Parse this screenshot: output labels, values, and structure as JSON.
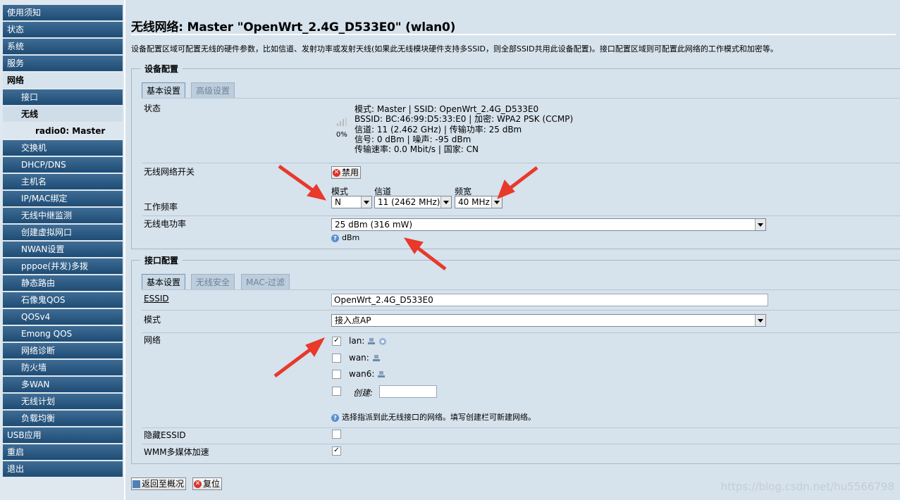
{
  "sidebar": {
    "items": [
      {
        "label": "使用须知"
      },
      {
        "label": "状态"
      },
      {
        "label": "系统"
      },
      {
        "label": "服务"
      },
      {
        "label": "网络"
      },
      {
        "label": "接口"
      },
      {
        "label": "无线"
      },
      {
        "label": "radio0: Master"
      },
      {
        "label": "交换机"
      },
      {
        "label": "DHCP/DNS"
      },
      {
        "label": "主机名"
      },
      {
        "label": "IP/MAC绑定"
      },
      {
        "label": "无线中继监测"
      },
      {
        "label": "创建虚拟网口"
      },
      {
        "label": "NWAN设置"
      },
      {
        "label": "pppoe(并发)多拨"
      },
      {
        "label": "静态路由"
      },
      {
        "label": "石像鬼QOS"
      },
      {
        "label": "QOSv4"
      },
      {
        "label": "Emong QOS"
      },
      {
        "label": "网络诊断"
      },
      {
        "label": "防火墙"
      },
      {
        "label": "多WAN"
      },
      {
        "label": "无线计划"
      },
      {
        "label": "负载均衡"
      },
      {
        "label": "USB应用"
      },
      {
        "label": "重启"
      },
      {
        "label": "退出"
      }
    ]
  },
  "page": {
    "title": "无线网络: Master \"OpenWrt_2.4G_D533E0\" (wlan0)",
    "description": "设备配置区域可配置无线的硬件参数，比如信道、发射功率或发射天线(如果此无线模块硬件支持多SSID，则全部SSID共用此设备配置)。接口配置区域则可配置此网络的工作模式和加密等。"
  },
  "device_config": {
    "legend": "设备配置",
    "tabs": [
      "基本设置",
      "高级设置"
    ],
    "status_label": "状态",
    "signal_percent": "0%",
    "status_lines": [
      "模式: Master | SSID: OpenWrt_2.4G_D533E0",
      "BSSID: BC:46:99:D5:33:E0 | 加密: WPA2 PSK (CCMP)",
      "信道: 11 (2.462 GHz) | 传输功率: 25 dBm",
      "信号: 0 dBm | 噪声: -95 dBm",
      "传输速率: 0.0 Mbit/s | 国家: CN"
    ],
    "switch_label": "无线网络开关",
    "disable_button": "禁用",
    "freq_label": "工作频率",
    "mode_caption": "模式",
    "mode_value": "N",
    "channel_caption": "信道",
    "channel_value": "11 (2462 MHz)",
    "width_caption": "频宽",
    "width_value": "40 MHz",
    "power_label": "无线电功率",
    "power_value": "25 dBm (316 mW)",
    "power_unit": "dBm"
  },
  "iface_config": {
    "legend": "接口配置",
    "tabs": [
      "基本设置",
      "无线安全",
      "MAC-过滤"
    ],
    "essid_label": "ESSID",
    "essid_value": "OpenWrt_2.4G_D533E0",
    "mode_label": "模式",
    "mode_value": "接入点AP",
    "network_label": "网络",
    "networks": [
      {
        "name": "lan:",
        "checked": true
      },
      {
        "name": "wan:",
        "checked": false
      },
      {
        "name": "wan6:",
        "checked": false
      }
    ],
    "create_label": "创建:",
    "network_help": "选择指派到此无线接口的网络。填写创建栏可新建网络。",
    "hidden_essid_label": "隐藏ESSID",
    "hidden_essid_checked": false,
    "wmm_label": "WMM多媒体加速",
    "wmm_checked": true
  },
  "footer": {
    "back_button": "返回至概况",
    "reset_button": "复位"
  },
  "watermark": "https://blog.csdn.net/hu5566798",
  "colors": {
    "nav": "#2a5882",
    "accent_arrow": "#e8392b",
    "panel": "#d6e2ec"
  }
}
